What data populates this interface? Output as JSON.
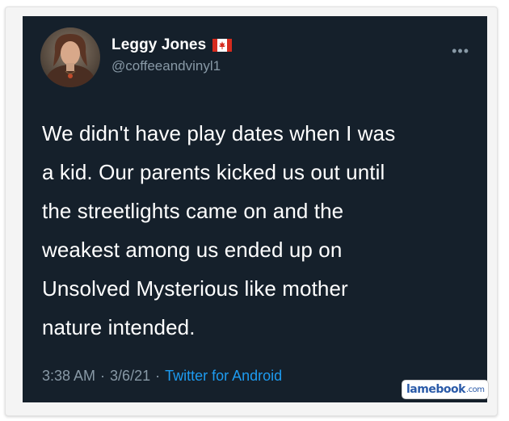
{
  "tweet": {
    "display_name": "Leggy Jones",
    "flag_icon": "canada-flag-icon",
    "handle": "@coffeeandvinyl1",
    "more_icon": "ellipsis-icon",
    "more_label": "•••",
    "lines": [
      "We didn't have play dates when I was",
      "a kid. Our parents kicked us out until",
      "the streetlights came on and the",
      "weakest among us ended up on",
      "Unsolved Mysterious like mother",
      "nature intended."
    ],
    "time": "3:38 AM",
    "separator": "·",
    "date": "3/6/21",
    "source": "Twitter for Android"
  },
  "watermark": {
    "name": "lamebook",
    "suffix": ".com"
  },
  "colors": {
    "background": "#15202b",
    "text": "#ffffff",
    "muted": "#8899a6",
    "link": "#1d9bf0"
  }
}
